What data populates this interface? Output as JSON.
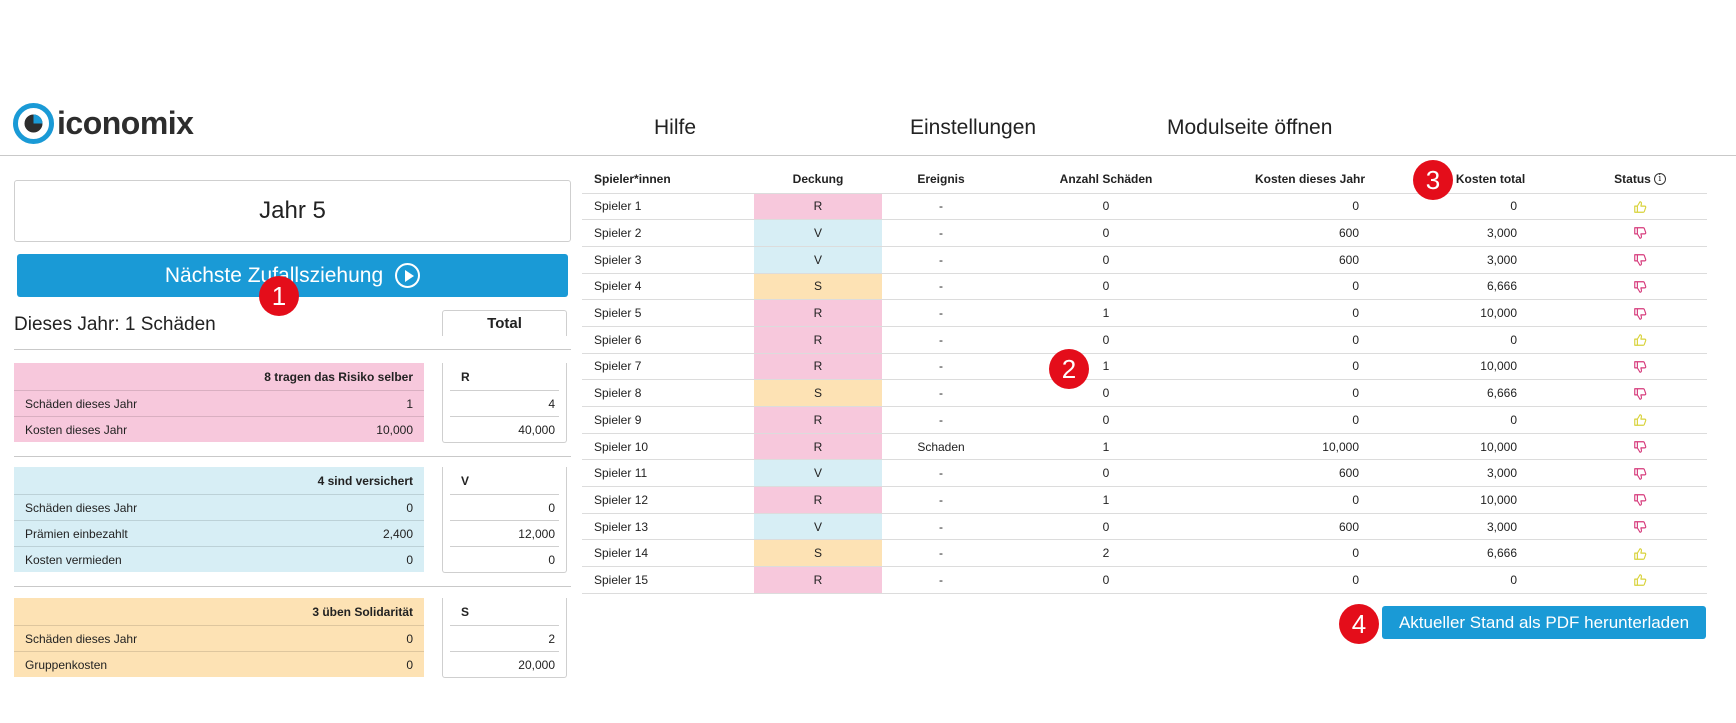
{
  "header": {
    "logo_text": "iconomix",
    "nav": [
      "Hilfe",
      "Einstellungen",
      "Modulseite öffnen"
    ]
  },
  "left": {
    "year_label": "Jahr 5",
    "next_button": "Nächste Zufallsziehung",
    "this_year": "Dieses Jahr: 1 Schäden",
    "total_label": "Total",
    "groups": [
      {
        "title": "8 tragen das Risiko selber",
        "total_code": "R",
        "rows": [
          {
            "label": "Schäden dieses Jahr",
            "value": "1",
            "total": "4"
          },
          {
            "label": "Kosten dieses Jahr",
            "value": "10,000",
            "total": "40,000"
          }
        ]
      },
      {
        "title": "4 sind versichert",
        "total_code": "V",
        "rows": [
          {
            "label": "Schäden dieses Jahr",
            "value": "0",
            "total": "0"
          },
          {
            "label": "Prämien einbezahlt",
            "value": "2,400",
            "total": "12,000"
          },
          {
            "label": "Kosten vermieden",
            "value": "0",
            "total": "0"
          }
        ]
      },
      {
        "title": "3 üben Solidarität",
        "total_code": "S",
        "rows": [
          {
            "label": "Schäden dieses Jahr",
            "value": "0",
            "total": "2"
          },
          {
            "label": "Gruppenkosten",
            "value": "0",
            "total": "20,000"
          }
        ]
      }
    ]
  },
  "table": {
    "headers": [
      "Spieler*innen",
      "Deckung",
      "Ereignis",
      "Anzahl Schäden",
      "Kosten dieses Jahr",
      "Kosten total",
      "Status"
    ],
    "rows": [
      {
        "name": "Spieler 1",
        "deckung": "R",
        "ereignis": "-",
        "anzahl": "0",
        "kdj": "0",
        "kt": "0",
        "status": "up"
      },
      {
        "name": "Spieler 2",
        "deckung": "V",
        "ereignis": "-",
        "anzahl": "0",
        "kdj": "600",
        "kt": "3,000",
        "status": "down"
      },
      {
        "name": "Spieler 3",
        "deckung": "V",
        "ereignis": "-",
        "anzahl": "0",
        "kdj": "600",
        "kt": "3,000",
        "status": "down"
      },
      {
        "name": "Spieler 4",
        "deckung": "S",
        "ereignis": "-",
        "anzahl": "0",
        "kdj": "0",
        "kt": "6,666",
        "status": "down"
      },
      {
        "name": "Spieler 5",
        "deckung": "R",
        "ereignis": "-",
        "anzahl": "1",
        "kdj": "0",
        "kt": "10,000",
        "status": "down"
      },
      {
        "name": "Spieler 6",
        "deckung": "R",
        "ereignis": "-",
        "anzahl": "0",
        "kdj": "0",
        "kt": "0",
        "status": "up"
      },
      {
        "name": "Spieler 7",
        "deckung": "R",
        "ereignis": "-",
        "anzahl": "1",
        "kdj": "0",
        "kt": "10,000",
        "status": "down"
      },
      {
        "name": "Spieler 8",
        "deckung": "S",
        "ereignis": "-",
        "anzahl": "0",
        "kdj": "0",
        "kt": "6,666",
        "status": "down"
      },
      {
        "name": "Spieler 9",
        "deckung": "R",
        "ereignis": "-",
        "anzahl": "0",
        "kdj": "0",
        "kt": "0",
        "status": "up"
      },
      {
        "name": "Spieler 10",
        "deckung": "R",
        "ereignis": "Schaden",
        "anzahl": "1",
        "kdj": "10,000",
        "kt": "10,000",
        "status": "down"
      },
      {
        "name": "Spieler 11",
        "deckung": "V",
        "ereignis": "-",
        "anzahl": "0",
        "kdj": "600",
        "kt": "3,000",
        "status": "down"
      },
      {
        "name": "Spieler 12",
        "deckung": "R",
        "ereignis": "-",
        "anzahl": "1",
        "kdj": "0",
        "kt": "10,000",
        "status": "down"
      },
      {
        "name": "Spieler 13",
        "deckung": "V",
        "ereignis": "-",
        "anzahl": "0",
        "kdj": "600",
        "kt": "3,000",
        "status": "down"
      },
      {
        "name": "Spieler 14",
        "deckung": "S",
        "ereignis": "-",
        "anzahl": "2",
        "kdj": "0",
        "kt": "6,666",
        "status": "up"
      },
      {
        "name": "Spieler 15",
        "deckung": "R",
        "ereignis": "-",
        "anzahl": "0",
        "kdj": "0",
        "kt": "0",
        "status": "up"
      }
    ]
  },
  "pdf_button": "Aktueller Stand als PDF herunterladen",
  "badges": [
    "1",
    "2",
    "3",
    "4"
  ],
  "colors": {
    "accent": "#1a9ad6",
    "R": "#f7c8dc",
    "V": "#d7eef5",
    "S": "#fde2b4",
    "badge": "#e40d1a",
    "thumb_up": "#d8d23a",
    "thumb_down": "#d6387a"
  },
  "icons": {
    "status_up": "thumbs-up-icon",
    "status_down": "thumbs-down-icon",
    "next": "play-circle-icon",
    "info": "info-icon"
  }
}
